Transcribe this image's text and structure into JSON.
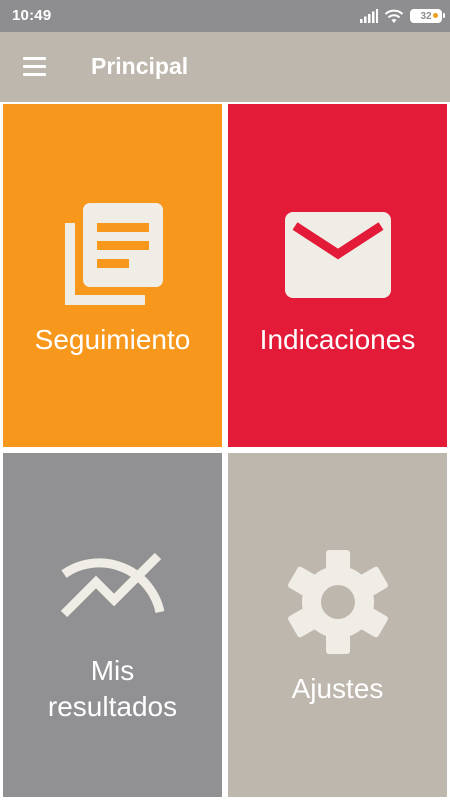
{
  "status_bar": {
    "time": "10:49",
    "battery_level": "32"
  },
  "app_bar": {
    "title": "Principal",
    "menu_icon": "hamburger-menu-icon"
  },
  "tiles": [
    {
      "label": "Seguimiento",
      "icon": "documents-icon",
      "color": "#f7981d"
    },
    {
      "label": "Indicaciones",
      "icon": "envelope-icon",
      "color": "#e31b38"
    },
    {
      "label": "Mis resultados",
      "label_lines": [
        "Mis",
        "resultados"
      ],
      "icon": "trending-chart-icon",
      "color": "#919194"
    },
    {
      "label": "Ajustes",
      "icon": "gear-icon",
      "color": "#beb7ae"
    }
  ],
  "colors": {
    "status_bar": "#8e8e90",
    "app_bar": "#beb7ae",
    "icon_fill": "#f0ece6"
  }
}
